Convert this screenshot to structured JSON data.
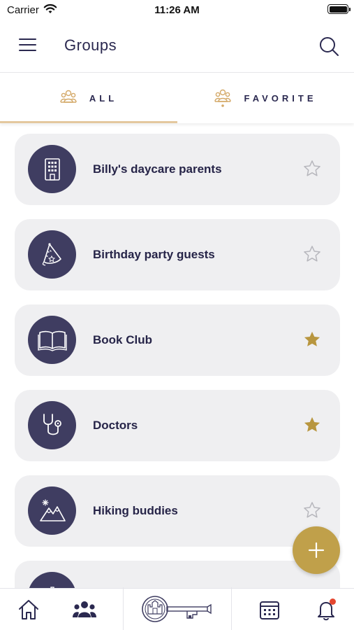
{
  "status_bar": {
    "carrier": "Carrier",
    "time": "11:26 AM"
  },
  "header": {
    "title": "Groups"
  },
  "tabs": [
    {
      "label": "ALL",
      "icon": "people-icon",
      "active": true
    },
    {
      "label": "FAVORITE",
      "icon": "people-favorite-icon",
      "active": false
    }
  ],
  "groups": [
    {
      "name": "Billy's daycare parents",
      "icon": "building-icon",
      "favorite": false
    },
    {
      "name": "Birthday party guests",
      "icon": "party-hat-icon",
      "favorite": false
    },
    {
      "name": "Book Club",
      "icon": "book-icon",
      "favorite": true
    },
    {
      "name": "Doctors",
      "icon": "stethoscope-icon",
      "favorite": true
    },
    {
      "name": "Hiking buddies",
      "icon": "mountain-icon",
      "favorite": false
    }
  ],
  "bottom_nav": [
    "home-icon",
    "groups-icon",
    "key-logo",
    "calendar-icon",
    "bell-icon"
  ],
  "colors": {
    "navy": "#3f3d61",
    "accent": "#c0a04a",
    "tab_underline": "#e4c89e",
    "card": "#efeff1",
    "notification": "#e4462f"
  }
}
